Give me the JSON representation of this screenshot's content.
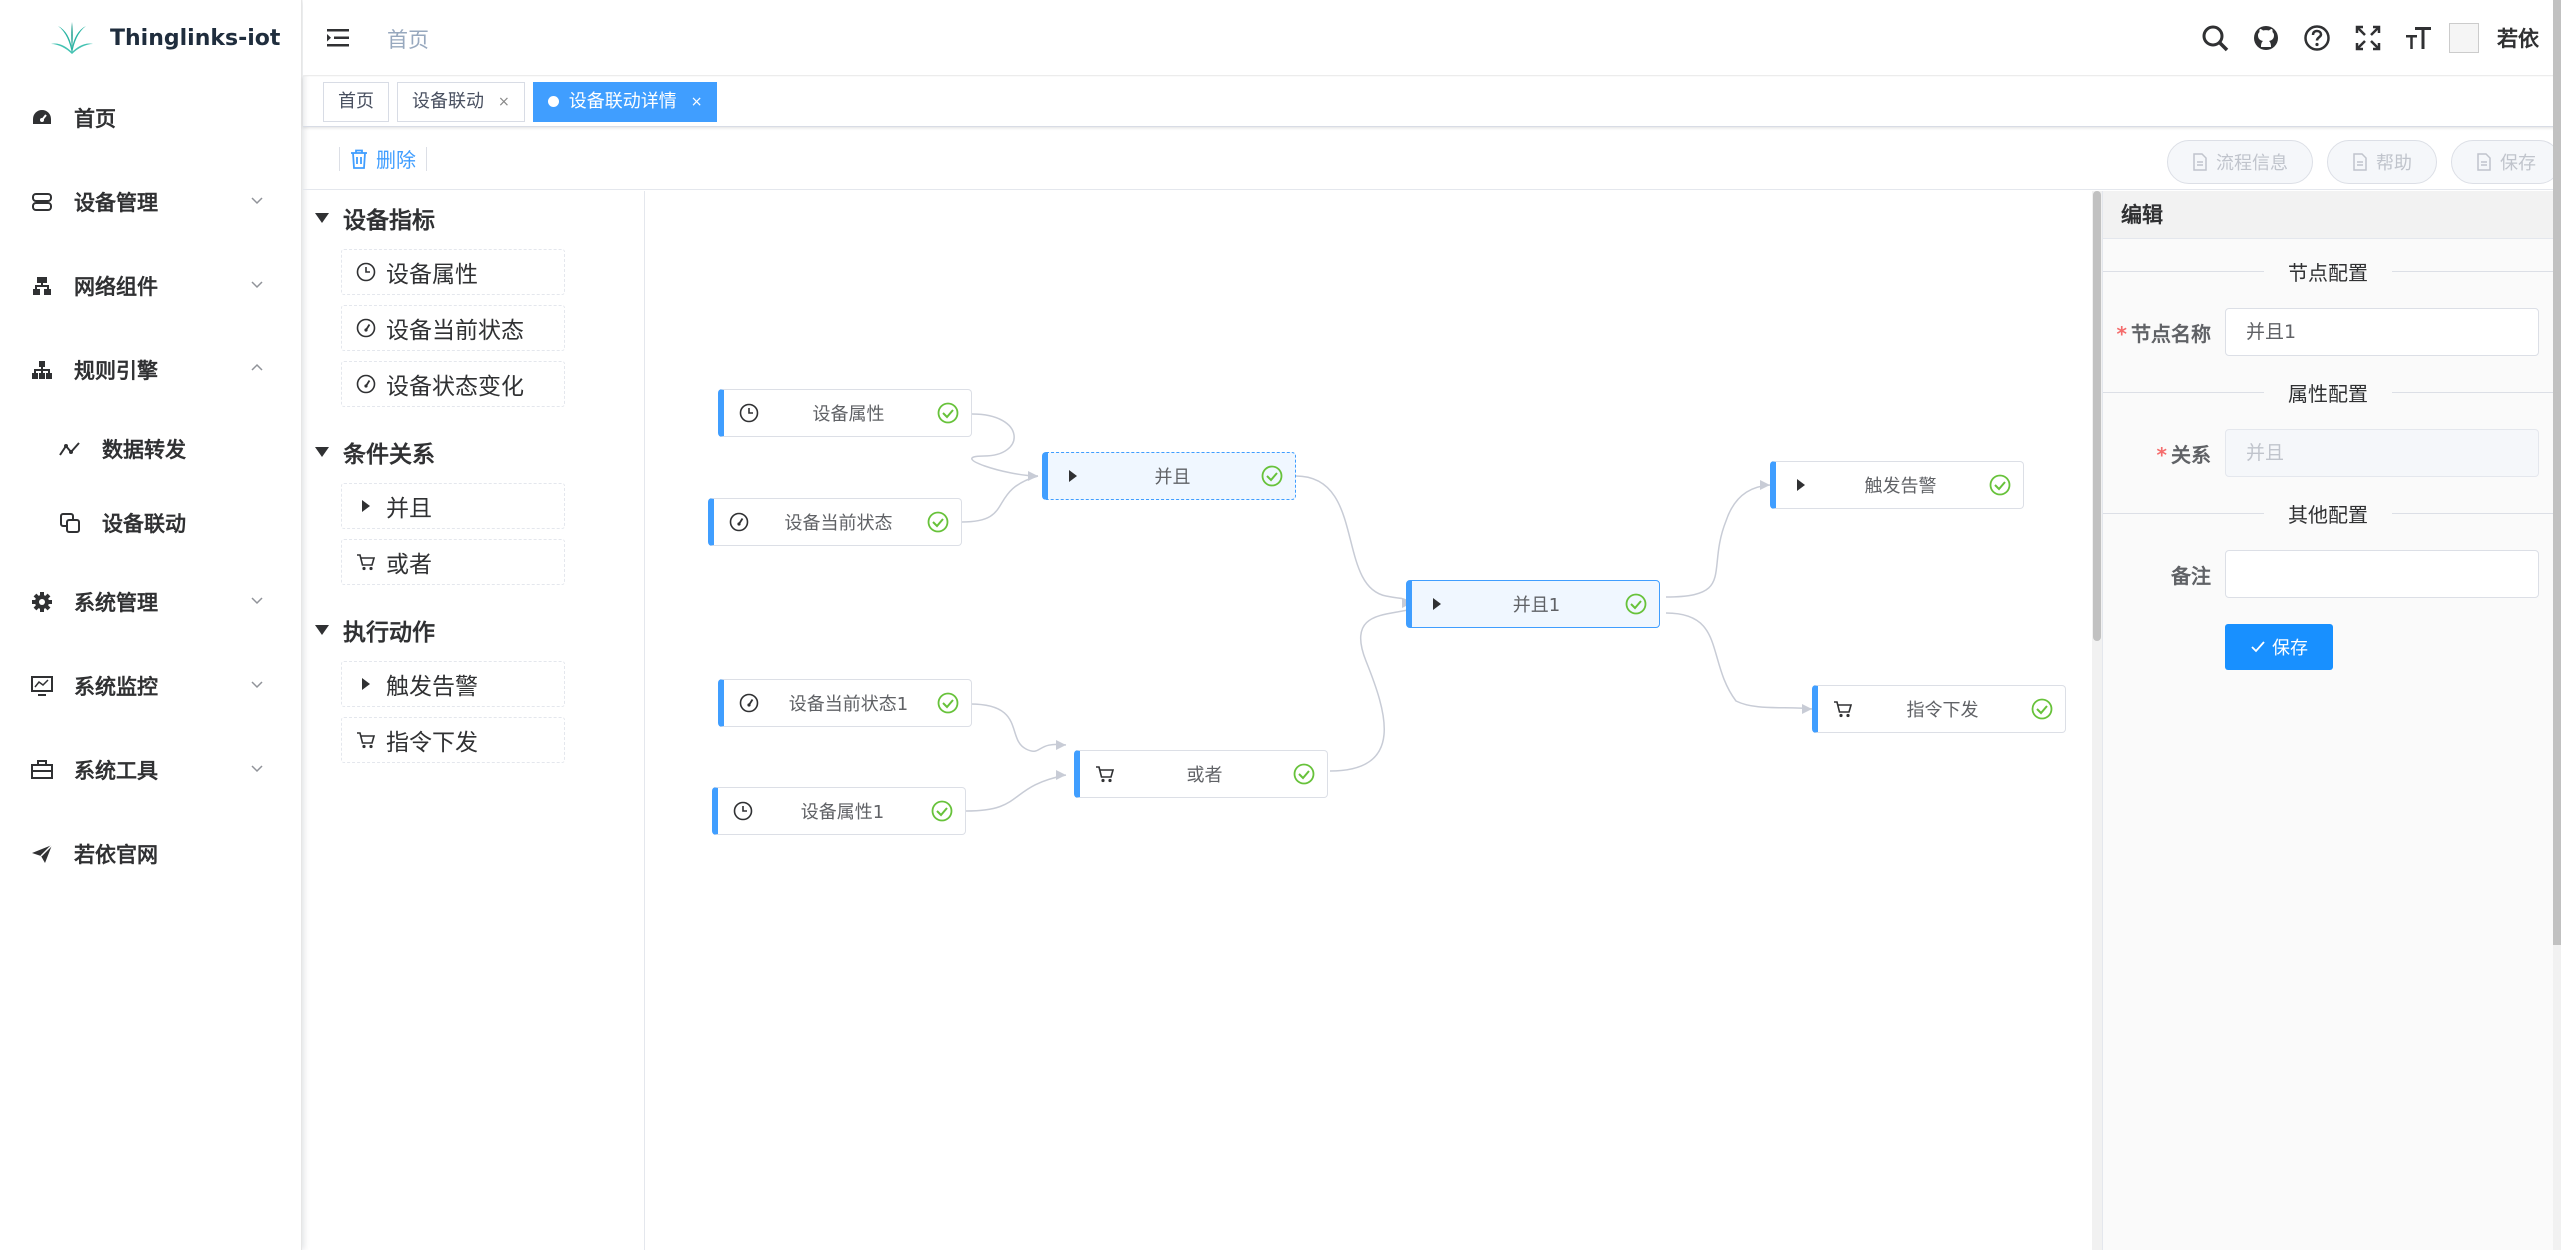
{
  "app": {
    "title": "Thinglinks-iot"
  },
  "sidebar": {
    "items": [
      {
        "label": "首页",
        "icon": "dashboard-icon"
      },
      {
        "label": "设备管理",
        "icon": "server-icon"
      },
      {
        "label": "网络组件",
        "icon": "network-icon"
      },
      {
        "label": "规则引擎",
        "icon": "tree-icon",
        "expanded": true,
        "children": [
          {
            "label": "数据转发",
            "icon": "chart-line-icon"
          },
          {
            "label": "设备联动",
            "icon": "copy-icon"
          }
        ]
      },
      {
        "label": "系统管理",
        "icon": "gear-icon"
      },
      {
        "label": "系统监控",
        "icon": "monitor-icon"
      },
      {
        "label": "系统工具",
        "icon": "toolbox-icon"
      },
      {
        "label": "若依官网",
        "icon": "send-icon"
      }
    ]
  },
  "header": {
    "breadcrumb": "首页",
    "username": "若依"
  },
  "tags": [
    {
      "label": "首页",
      "active": false,
      "closable": false
    },
    {
      "label": "设备联动",
      "active": false,
      "closable": true
    },
    {
      "label": "设备联动详情",
      "active": true,
      "closable": true
    }
  ],
  "toolbar": {
    "delete_label": "删除",
    "flow_info_label": "流程信息",
    "help_label": "帮助",
    "save_label": "保存"
  },
  "palette": {
    "groups": [
      {
        "title": "设备指标",
        "items": [
          {
            "label": "设备属性",
            "icon": "clock-icon"
          },
          {
            "label": "设备当前状态",
            "icon": "gauge-icon"
          },
          {
            "label": "设备状态变化",
            "icon": "gauge-icon"
          }
        ]
      },
      {
        "title": "条件关系",
        "items": [
          {
            "label": "并且",
            "icon": "play-icon"
          },
          {
            "label": "或者",
            "icon": "cart-icon"
          }
        ]
      },
      {
        "title": "执行动作",
        "items": [
          {
            "label": "触发告警",
            "icon": "play-icon"
          },
          {
            "label": "指令下发",
            "icon": "cart-icon"
          }
        ]
      }
    ]
  },
  "flow": {
    "nodes": [
      {
        "id": "n1",
        "label": "设备属性",
        "icon": "clock-icon",
        "state": "normal"
      },
      {
        "id": "n2",
        "label": "设备当前状态",
        "icon": "gauge-icon",
        "state": "normal"
      },
      {
        "id": "n3",
        "label": "并且",
        "icon": "play-icon",
        "state": "active"
      },
      {
        "id": "n4",
        "label": "设备当前状态1",
        "icon": "gauge-icon",
        "state": "normal"
      },
      {
        "id": "n5",
        "label": "设备属性1",
        "icon": "clock-icon",
        "state": "normal"
      },
      {
        "id": "n6",
        "label": "或者",
        "icon": "cart-icon",
        "state": "normal"
      },
      {
        "id": "n7",
        "label": "并且1",
        "icon": "play-icon",
        "state": "selected"
      },
      {
        "id": "n8",
        "label": "触发告警",
        "icon": "play-icon",
        "state": "normal"
      },
      {
        "id": "n9",
        "label": "指令下发",
        "icon": "cart-icon",
        "state": "normal"
      }
    ],
    "edges": [
      [
        "n1",
        "n3"
      ],
      [
        "n2",
        "n3"
      ],
      [
        "n4",
        "n6"
      ],
      [
        "n5",
        "n6"
      ],
      [
        "n3",
        "n7"
      ],
      [
        "n6",
        "n7"
      ],
      [
        "n7",
        "n8"
      ],
      [
        "n7",
        "n9"
      ]
    ]
  },
  "editor": {
    "title": "编辑",
    "section_node": "节点配置",
    "node_name_label": "节点名称",
    "node_name_value": "并且1",
    "section_attr": "属性配置",
    "relation_label": "关系",
    "relation_placeholder": "并且",
    "section_other": "其他配置",
    "remark_label": "备注",
    "remark_value": "",
    "save_label": "保存"
  },
  "colors": {
    "primary": "#409eff",
    "success": "#67c23a",
    "danger": "#f56c6c",
    "saveBtn": "#1890ff"
  }
}
